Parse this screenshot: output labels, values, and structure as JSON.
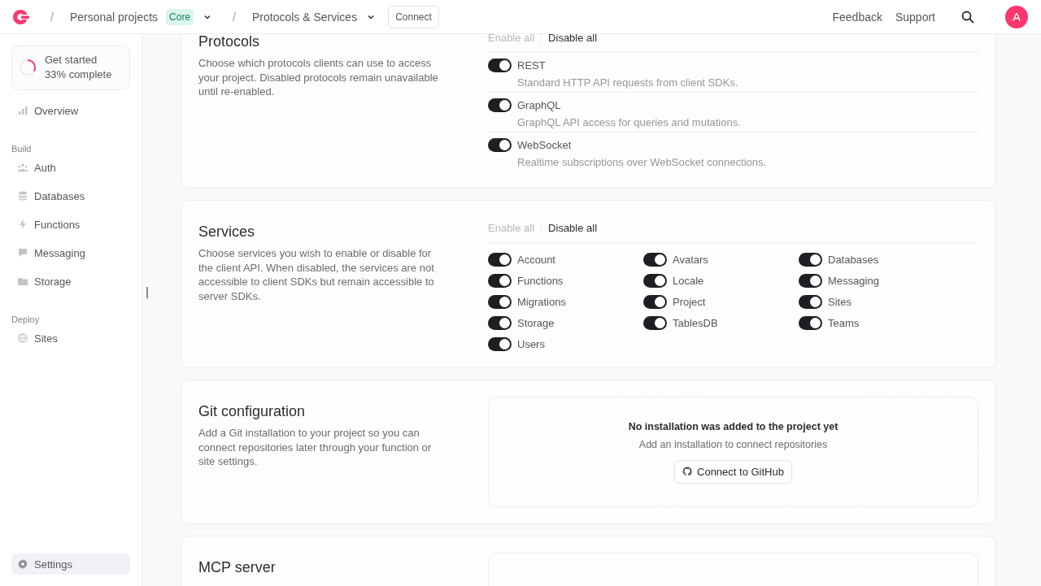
{
  "header": {
    "breadcrumbs": [
      {
        "separator": "/",
        "label": "Personal projects",
        "badge": "Core"
      },
      {
        "separator": "/",
        "label": "Protocols & Services"
      }
    ],
    "connect_button": "Connect",
    "links": [
      "Feedback",
      "Support"
    ],
    "avatar": "A"
  },
  "sidebar": {
    "progress": {
      "title": "Get started",
      "subtitle": "33% complete",
      "level": 0.33
    },
    "groups": [
      {
        "items": [
          {
            "label": "Overview",
            "selected": false
          }
        ]
      },
      {
        "heading": "Build",
        "items": [
          {
            "label": "Auth",
            "selected": false
          },
          {
            "label": "Databases",
            "selected": false
          },
          {
            "label": "Functions",
            "selected": false
          },
          {
            "label": "Messaging",
            "selected": false
          },
          {
            "label": "Storage",
            "selected": false
          }
        ]
      },
      {
        "heading": "Deploy",
        "items": [
          {
            "label": "Sites",
            "selected": false
          }
        ]
      }
    ],
    "footer_item": {
      "label": "Settings",
      "selected": true
    }
  },
  "sections": [
    {
      "kind": "toggle_list",
      "title": "Protocols",
      "description": "Choose which protocols clients can use to access your project. Disabled protocols remain unavailable until re-enabled.",
      "enable_all": {
        "label": "Enable all",
        "disabled": true
      },
      "disable_all": {
        "label": "Disable all",
        "disabled": false
      },
      "items": [
        {
          "label": "REST",
          "description": "Standard HTTP API requests from client SDKs.",
          "on": true
        },
        {
          "label": "GraphQL",
          "description": "GraphQL API access for queries and mutations.",
          "on": true
        },
        {
          "label": "WebSocket",
          "description": "Realtime subscriptions over WebSocket connections.",
          "on": true
        }
      ]
    },
    {
      "kind": "toggle_grid",
      "title": "Services",
      "description": "Choose services you wish to enable or disable for the client API. When disabled, the services are not accessible to client SDKs but remain accessible to server SDKs.",
      "enable_all": {
        "label": "Enable all",
        "disabled": true
      },
      "disable_all": {
        "label": "Disable all",
        "disabled": false
      },
      "items": [
        {
          "label": "Account",
          "on": true
        },
        {
          "label": "Avatars",
          "on": true
        },
        {
          "label": "Databases",
          "on": true
        },
        {
          "label": "Functions",
          "on": true
        },
        {
          "label": "Locale",
          "on": true
        },
        {
          "label": "Messaging",
          "on": true
        },
        {
          "label": "Migrations",
          "on": true
        },
        {
          "label": "Project",
          "on": true
        },
        {
          "label": "Sites",
          "on": true
        },
        {
          "label": "Storage",
          "on": true
        },
        {
          "label": "TablesDB",
          "on": true
        },
        {
          "label": "Teams",
          "on": true
        },
        {
          "label": "Users",
          "on": true
        }
      ]
    },
    {
      "kind": "empty",
      "title": "Git configuration",
      "description": "Add a Git installation to your project so you can connect repositories later through your function or site settings.",
      "empty_title": "No installation was added to the project yet",
      "empty_text": "Add an installation to connect repositories",
      "button": "Connect to GitHub"
    },
    {
      "kind": "empty",
      "title": "MCP server"
    }
  ]
}
